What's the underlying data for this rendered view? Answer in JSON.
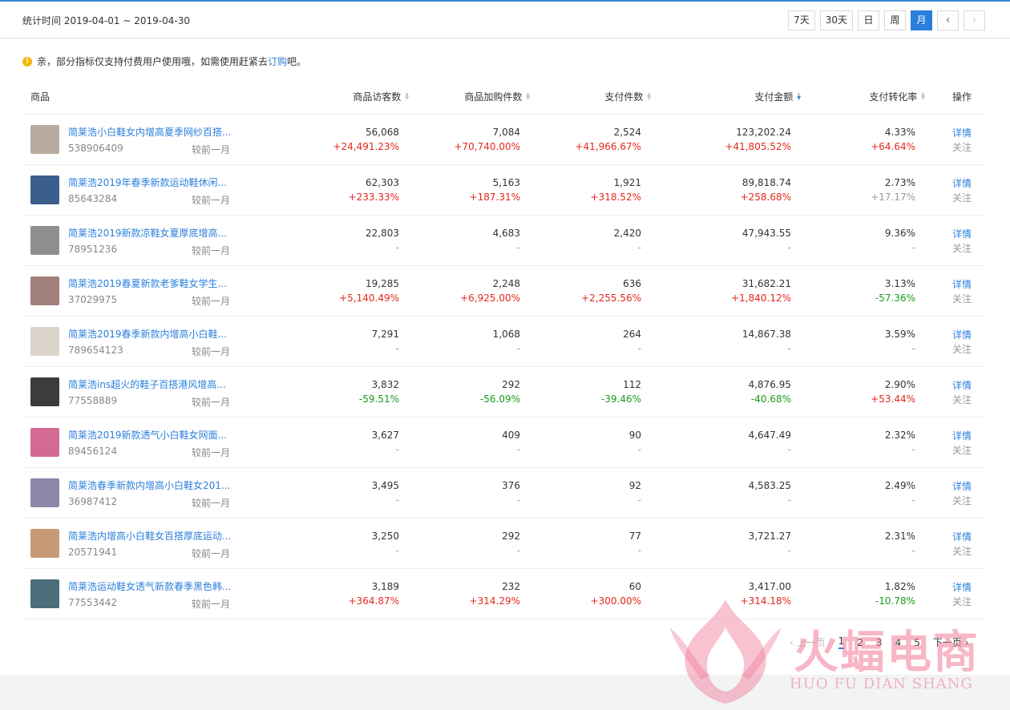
{
  "header": {
    "date_range": "统计时间 2019-04-01 ~ 2019-04-30",
    "periods": [
      "7天",
      "30天",
      "日",
      "周",
      "月"
    ],
    "active_period": "月",
    "prev": "‹",
    "next": "›"
  },
  "notice": {
    "text_before": "亲，部分指标仅支持付费用户使用哦，如需使用赶紧去",
    "link": "订购",
    "text_after": "吧。"
  },
  "table": {
    "columns": [
      "商品",
      "商品访客数",
      "商品加购件数",
      "支付件数",
      "支付金额",
      "支付转化率",
      "操作"
    ],
    "sorted_column": "支付金额",
    "compare_label": "较前一月",
    "detail_label": "详情",
    "follow_label": "关注",
    "rows": [
      {
        "name": "简莱浩小白鞋女内增高夏季网纱百搭...",
        "id": "538906409",
        "thumb": "#b8aa9e",
        "visitors": "56,068",
        "visitors_d": "+24,491.23%",
        "visitors_t": "up",
        "cart": "7,084",
        "cart_d": "+70,740.00%",
        "cart_t": "up",
        "pay_qty": "2,524",
        "pay_qty_d": "+41,966.67%",
        "pay_qty_t": "up",
        "amount": "123,202.24",
        "amount_d": "+41,805.52%",
        "amount_t": "up",
        "rate": "4.33%",
        "rate_d": "+64.64%",
        "rate_t": "up"
      },
      {
        "name": "简莱浩2019年春季新款运动鞋休闲...",
        "id": "85643284",
        "thumb": "#3a5f8c",
        "visitors": "62,303",
        "visitors_d": "+233.33%",
        "visitors_t": "up",
        "cart": "5,163",
        "cart_d": "+187.31%",
        "cart_t": "up",
        "pay_qty": "1,921",
        "pay_qty_d": "+318.52%",
        "pay_qty_t": "up",
        "amount": "89,818.74",
        "amount_d": "+258.68%",
        "amount_t": "up",
        "rate": "2.73%",
        "rate_d": "+17.17%",
        "rate_t": "flat"
      },
      {
        "name": "简莱浩2019新款凉鞋女夏厚底增高...",
        "id": "78951236",
        "thumb": "#8f8f8f",
        "visitors": "22,803",
        "visitors_d": "-",
        "visitors_t": "flat",
        "cart": "4,683",
        "cart_d": "-",
        "cart_t": "flat",
        "pay_qty": "2,420",
        "pay_qty_d": "-",
        "pay_qty_t": "flat",
        "amount": "47,943.55",
        "amount_d": "-",
        "amount_t": "flat",
        "rate": "9.36%",
        "rate_d": "-",
        "rate_t": "flat"
      },
      {
        "name": "简莱浩2019春夏新款老爹鞋女学生...",
        "id": "37029975",
        "thumb": "#a2807a",
        "visitors": "19,285",
        "visitors_d": "+5,140.49%",
        "visitors_t": "up",
        "cart": "2,248",
        "cart_d": "+6,925.00%",
        "cart_t": "up",
        "pay_qty": "636",
        "pay_qty_d": "+2,255.56%",
        "pay_qty_t": "up",
        "amount": "31,682.21",
        "amount_d": "+1,840.12%",
        "amount_t": "up",
        "rate": "3.13%",
        "rate_d": "-57.36%",
        "rate_t": "down"
      },
      {
        "name": "简莱浩2019春季新款内增高小白鞋...",
        "id": "789654123",
        "thumb": "#d9d3c9",
        "visitors": "7,291",
        "visitors_d": "-",
        "visitors_t": "flat",
        "cart": "1,068",
        "cart_d": "-",
        "cart_t": "flat",
        "pay_qty": "264",
        "pay_qty_d": "-",
        "pay_qty_t": "flat",
        "amount": "14,867.38",
        "amount_d": "-",
        "amount_t": "flat",
        "rate": "3.59%",
        "rate_d": "-",
        "rate_t": "flat"
      },
      {
        "name": "简莱浩ins超火的鞋子百搭港风增高...",
        "id": "77558889",
        "thumb": "#3c3c3c",
        "visitors": "3,832",
        "visitors_d": "-59.51%",
        "visitors_t": "down",
        "cart": "292",
        "cart_d": "-56.09%",
        "cart_t": "down",
        "pay_qty": "112",
        "pay_qty_d": "-39.46%",
        "pay_qty_t": "down",
        "amount": "4,876.95",
        "amount_d": "-40.68%",
        "amount_t": "down",
        "rate": "2.90%",
        "rate_d": "+53.44%",
        "rate_t": "up"
      },
      {
        "name": "简莱浩2019新款透气小白鞋女网面...",
        "id": "89456124",
        "thumb": "#d26a94",
        "visitors": "3,627",
        "visitors_d": "-",
        "visitors_t": "flat",
        "cart": "409",
        "cart_d": "-",
        "cart_t": "flat",
        "pay_qty": "90",
        "pay_qty_d": "-",
        "pay_qty_t": "flat",
        "amount": "4,647.49",
        "amount_d": "-",
        "amount_t": "flat",
        "rate": "2.32%",
        "rate_d": "-",
        "rate_t": "flat"
      },
      {
        "name": "简莱浩春季新款内增高小白鞋女201...",
        "id": "36987412",
        "thumb": "#8d86a8",
        "visitors": "3,495",
        "visitors_d": "-",
        "visitors_t": "flat",
        "cart": "376",
        "cart_d": "-",
        "cart_t": "flat",
        "pay_qty": "92",
        "pay_qty_d": "-",
        "pay_qty_t": "flat",
        "amount": "4,583.25",
        "amount_d": "-",
        "amount_t": "flat",
        "rate": "2.49%",
        "rate_d": "-",
        "rate_t": "flat"
      },
      {
        "name": "简莱浩内增高小白鞋女百搭厚底运动...",
        "id": "20571941",
        "thumb": "#c99a76",
        "visitors": "3,250",
        "visitors_d": "-",
        "visitors_t": "flat",
        "cart": "292",
        "cart_d": "-",
        "cart_t": "flat",
        "pay_qty": "77",
        "pay_qty_d": "-",
        "pay_qty_t": "flat",
        "amount": "3,721.27",
        "amount_d": "-",
        "amount_t": "flat",
        "rate": "2.31%",
        "rate_d": "-",
        "rate_t": "flat"
      },
      {
        "name": "简莱浩运动鞋女透气新款春季黑色韩...",
        "id": "77553442",
        "thumb": "#4a6e7a",
        "visitors": "3,189",
        "visitors_d": "+364.87%",
        "visitors_t": "up",
        "cart": "232",
        "cart_d": "+314.29%",
        "cart_t": "up",
        "pay_qty": "60",
        "pay_qty_d": "+300.00%",
        "pay_qty_t": "up",
        "amount": "3,417.00",
        "amount_d": "+314.18%",
        "amount_t": "up",
        "rate": "1.82%",
        "rate_d": "-10.78%",
        "rate_t": "down"
      }
    ]
  },
  "pagination": {
    "prev": "‹ 上一页",
    "pages": [
      "1",
      "2",
      "3",
      "4",
      "5"
    ],
    "current": "1",
    "next": "下一页 ›"
  },
  "watermark": {
    "text": "火蝠电商",
    "sub": "HUO FU DIAN SHANG"
  }
}
